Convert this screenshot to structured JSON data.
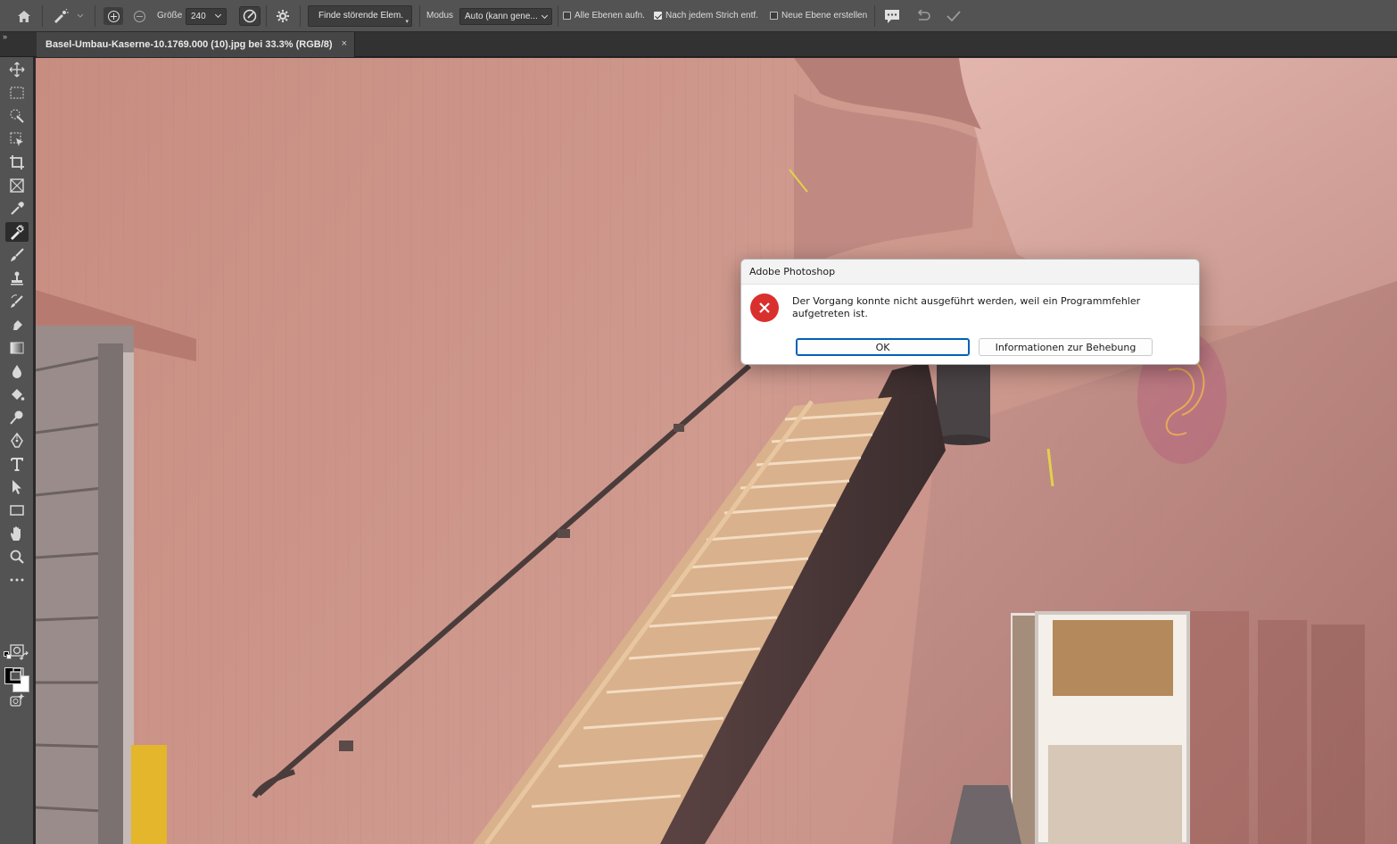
{
  "options_bar": {
    "size_label": "Größe",
    "size_value": "240",
    "find_button": "Finde störende Elem.",
    "mode_label": "Modus",
    "mode_value": "Auto (kann gene...",
    "checkbox_all_layers": "Alle Ebenen aufn.",
    "checkbox_all_layers_checked": false,
    "checkbox_after_stroke": "Nach jedem Strich entf.",
    "checkbox_after_stroke_checked": true,
    "checkbox_new_layer": "Neue Ebene erstellen",
    "checkbox_new_layer_checked": false
  },
  "tabs": {
    "collapse_glyph": "»",
    "document_title": "Basel-Umbau-Kaserne-10.1769.000 (10).jpg bei 33.3% (RGB/8)",
    "close_glyph": "×"
  },
  "toolbar": {
    "tools": [
      "move-icon",
      "marquee-icon",
      "quick-selection-icon",
      "object-selection-icon",
      "crop-icon",
      "frame-icon",
      "eyedropper-icon",
      "remove-tool-icon",
      "brush-icon",
      "stamp-icon",
      "history-brush-icon",
      "eraser-icon",
      "gradient-icon",
      "blur-icon",
      "paint-bucket-icon",
      "dodge-icon",
      "pen-icon",
      "type-icon",
      "path-selection-icon",
      "rectangle-icon",
      "hand-icon",
      "zoom-icon",
      "more-tools-icon",
      "quick-mask-icon",
      "screen-mode-icon",
      "generative-icon"
    ],
    "active_tool": "remove-tool-icon",
    "foreground_color": "#000000",
    "background_color": "#ffffff"
  },
  "dialog": {
    "title": "Adobe Photoshop",
    "message": "Der Vorgang konnte nicht ausgeführt werden, weil ein Programmfehler aufgetreten ist.",
    "ok_label": "OK",
    "info_label": "Informationen zur Behebung",
    "icon": "error-icon",
    "accent_color": "#005fb8",
    "error_color": "#d9302e"
  }
}
